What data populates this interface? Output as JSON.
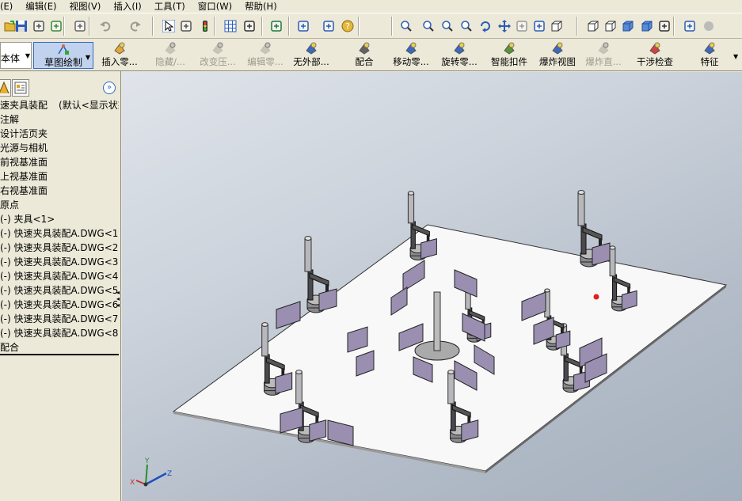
{
  "menus": [
    "(E)",
    "编辑(E)",
    "视图(V)",
    "插入(I)",
    "工具(T)",
    "窗口(W)",
    "帮助(H)"
  ],
  "toolbar_icons": [
    "open-icon",
    "save-icon",
    "print-preview-icon",
    "options-icon",
    "print-icon",
    "undo-icon",
    "redo-icon",
    "select-icon",
    "select-filter-icon",
    "traffic-light-icon",
    "grid-icon",
    "dimension-icon",
    "3d-sketch-icon",
    "view-panel-icon",
    "properties-icon",
    "help-icon",
    "zoom-to-fit-icon",
    "zoom-area-icon",
    "zoom-in-out-icon",
    "zoom-selection-icon",
    "rotate-icon",
    "pan-icon",
    "3d-drawing-view-icon",
    "standard-views-icon",
    "wireframe-icon",
    "hidden-lines-visible-icon",
    "hidden-lines-removed-icon",
    "shaded-with-edges-icon",
    "shaded-icon",
    "monitor-icon",
    "section-view-icon",
    "appearance-icon"
  ],
  "command_manager": {
    "left_tab": "本体",
    "sketch_tab": "草图绘制",
    "commands": [
      {
        "label": "插入零...",
        "disabled": false
      },
      {
        "label": "隐藏/...",
        "disabled": true
      },
      {
        "label": "改变压...",
        "disabled": true
      },
      {
        "label": "编辑零...",
        "disabled": true
      },
      {
        "label": "无外部...",
        "disabled": false
      },
      {
        "label": "配合",
        "disabled": false
      },
      {
        "label": "移动零...",
        "disabled": false
      },
      {
        "label": "旋转零...",
        "disabled": false
      },
      {
        "label": "智能扣件",
        "disabled": false
      },
      {
        "label": "爆炸视图",
        "disabled": false
      },
      {
        "label": "爆炸直...",
        "disabled": true
      },
      {
        "label": "干涉检查",
        "disabled": false
      },
      {
        "label": "特征",
        "disabled": false
      }
    ]
  },
  "feature_tree": {
    "root": "速夹具装配",
    "root_config": "(默认<显示状态",
    "items": [
      "注解",
      "设计活页夹",
      "光源与相机",
      "前视基准面",
      "上视基准面",
      "右视基准面",
      "原点",
      "(-) 夹具<1>",
      "(-) 快速夹具装配A.DWG<1>",
      "(-) 快速夹具装配A.DWG<2>",
      "(-) 快速夹具装配A.DWG<3>",
      "(-) 快速夹具装配A.DWG<4>",
      "(-) 快速夹具装配A.DWG<5>",
      "(-) 快速夹具装配A.DWG<6>",
      "(-) 快速夹具装配A.DWG<7>",
      "(-) 快速夹具装配A.DWG<8>",
      "配合"
    ]
  },
  "triad": {
    "x": "X",
    "y": "Y",
    "z": "Z"
  },
  "colors": {
    "plate": "#f8f8f8",
    "clamp_dark": "#4a4a4e",
    "clamp_mid": "#8a8a8e",
    "fin": "#9a8fb0",
    "triad_x": "#c0392b",
    "triad_y": "#2e8b2e",
    "triad_z": "#1f4fbf"
  }
}
